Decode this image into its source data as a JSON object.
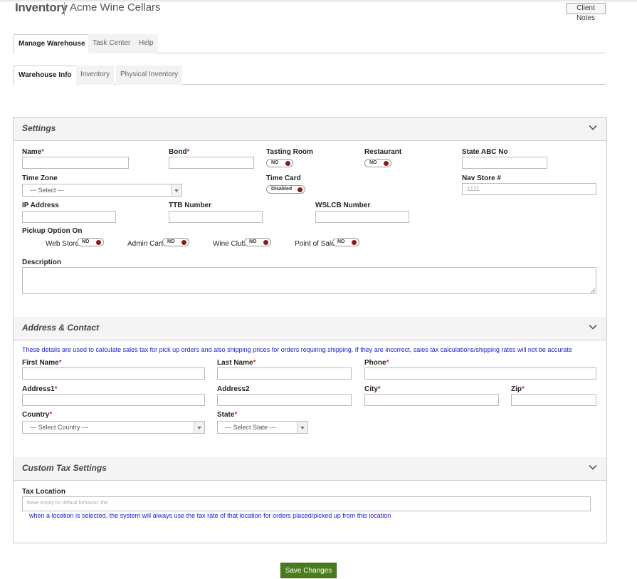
{
  "header": {
    "title": "Inventory",
    "subtitle": "Acme Wine Cellars",
    "client_notes": "Client Notes"
  },
  "tabs_main": [
    "Manage Warehouse",
    "Task Center",
    "Help"
  ],
  "tabs_sub": [
    "Warehouse Info",
    "Inventory",
    "Physical Inventory"
  ],
  "settings": {
    "title": "Settings",
    "name_label": "Name",
    "bond_label": "Bond",
    "tasting_room_label": "Tasting Room",
    "tasting_room_value": "NO",
    "restaurant_label": "Restaurant",
    "restaurant_value": "NO",
    "state_abc_label": "State ABC No",
    "timezone_label": "Time Zone",
    "timezone_value": "--- Select ---",
    "timecard_label": "Time Card",
    "timecard_value": "Disabled",
    "nav_store_label": "Nav Store #",
    "nav_store_placeholder": "1111",
    "ip_label": "IP Address",
    "ttb_label": "TTB Number",
    "wslcb_label": "WSLCB Number",
    "pickup_label": "Pickup Option On",
    "pickup": [
      {
        "label": "Web Store",
        "value": "NO"
      },
      {
        "label": "Admin Cart",
        "value": "NO"
      },
      {
        "label": "Wine Club",
        "value": "NO"
      },
      {
        "label": "Point of Sale",
        "value": "NO"
      }
    ],
    "description_label": "Description"
  },
  "address": {
    "title": "Address & Contact",
    "info": "These details are used to calculate sales tax for pick up orders and also shipping prices for orders requiring shipping. If they are incorrect, sales tax calculations/shipping rates will not be accurate",
    "first_name_label": "First Name",
    "last_name_label": "Last Name",
    "phone_label": "Phone",
    "address1_label": "Address1",
    "address2_label": "Address2",
    "city_label": "City",
    "zip_label": "Zip",
    "country_label": "Country",
    "country_value": "--- Select Country ---",
    "state_label": "State",
    "state_value": "--- Select State ---"
  },
  "tax": {
    "title": "Custom Tax Settings",
    "location_label": "Tax Location",
    "location_placeholder": "leave empty for default behavior: the",
    "info": "when a location is selected, the system will always use the tax rate of that location for orders placed/picked up from this location"
  },
  "save_label": "Save Changes",
  "colors": {
    "accent_green": "#4a7c1f",
    "toggle_dot": "#8b1a1a",
    "info_blue": "#1a1acc",
    "required": "#c0392b"
  }
}
